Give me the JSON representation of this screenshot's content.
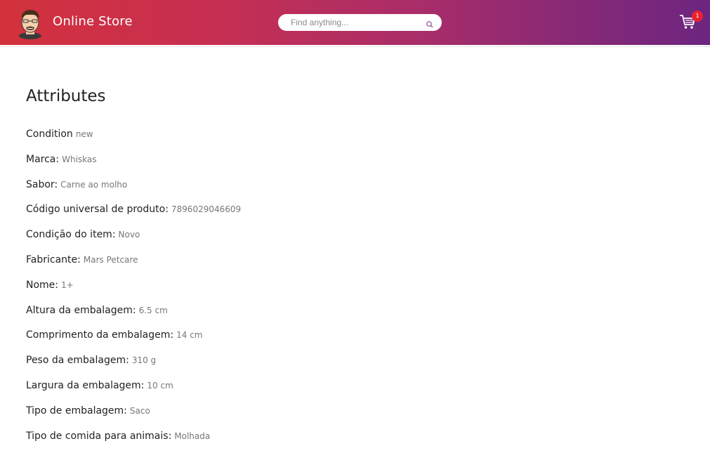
{
  "header": {
    "brand": "Online Store",
    "search_placeholder": "Find anything...",
    "cart_count": "1",
    "logo_icon": "cartoon-face-avatar",
    "search_icon": "search-icon",
    "cart_icon": "shopping-cart-icon",
    "gradient_colors": [
      "#d3313c",
      "#a72d6a",
      "#6c2580"
    ],
    "badge_color": "#e8232f"
  },
  "attributes": {
    "title": "Attributes",
    "items": [
      {
        "name": "Condition",
        "value": "new"
      },
      {
        "name": "Marca:",
        "value": "Whiskas"
      },
      {
        "name": "Sabor:",
        "value": "Carne ao molho"
      },
      {
        "name": "Código universal de produto:",
        "value": "7896029046609"
      },
      {
        "name": "Condição do item:",
        "value": "Novo"
      },
      {
        "name": "Fabricante:",
        "value": "Mars Petcare"
      },
      {
        "name": "Nome:",
        "value": "1+"
      },
      {
        "name": "Altura da embalagem:",
        "value": "6.5 cm"
      },
      {
        "name": "Comprimento da embalagem:",
        "value": "14 cm"
      },
      {
        "name": "Peso da embalagem:",
        "value": "310 g"
      },
      {
        "name": "Largura da embalagem:",
        "value": "10 cm"
      },
      {
        "name": "Tipo de embalagem:",
        "value": "Saco"
      },
      {
        "name": "Tipo de comida para animais:",
        "value": "Molhada"
      }
    ]
  }
}
